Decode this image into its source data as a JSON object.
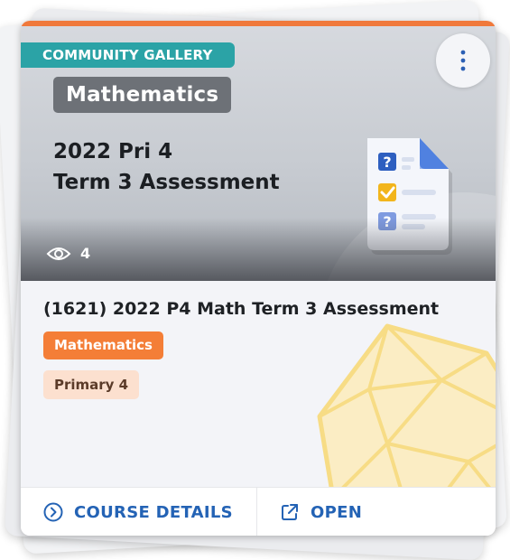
{
  "card": {
    "badge": "COMMUNITY GALLERY",
    "subject_chip": "Mathematics",
    "banner_title_line1": "2022 Pri 4",
    "banner_title_line2": "Term 3 Assessment",
    "views_count": "4",
    "course_title": "(1621) 2022 P4 Math Term 3 Assessment",
    "tags": [
      "Mathematics",
      "Primary 4"
    ],
    "actions": {
      "course_details": "COURSE DETAILS",
      "open": "OPEN"
    }
  },
  "icons": {
    "menu": "more-vertical-icon",
    "views": "eye-icon",
    "quiz": "quiz-document-icon",
    "details": "chevron-circle-right-icon",
    "open": "external-link-icon"
  },
  "colors": {
    "accent_stripe": "#f0793b",
    "gallery_badge": "#2ba3a6",
    "subject_chip": "#6d7177",
    "math_tag": "#f47e37",
    "level_tag": "#fce0cf",
    "action_text": "#2463b5"
  }
}
